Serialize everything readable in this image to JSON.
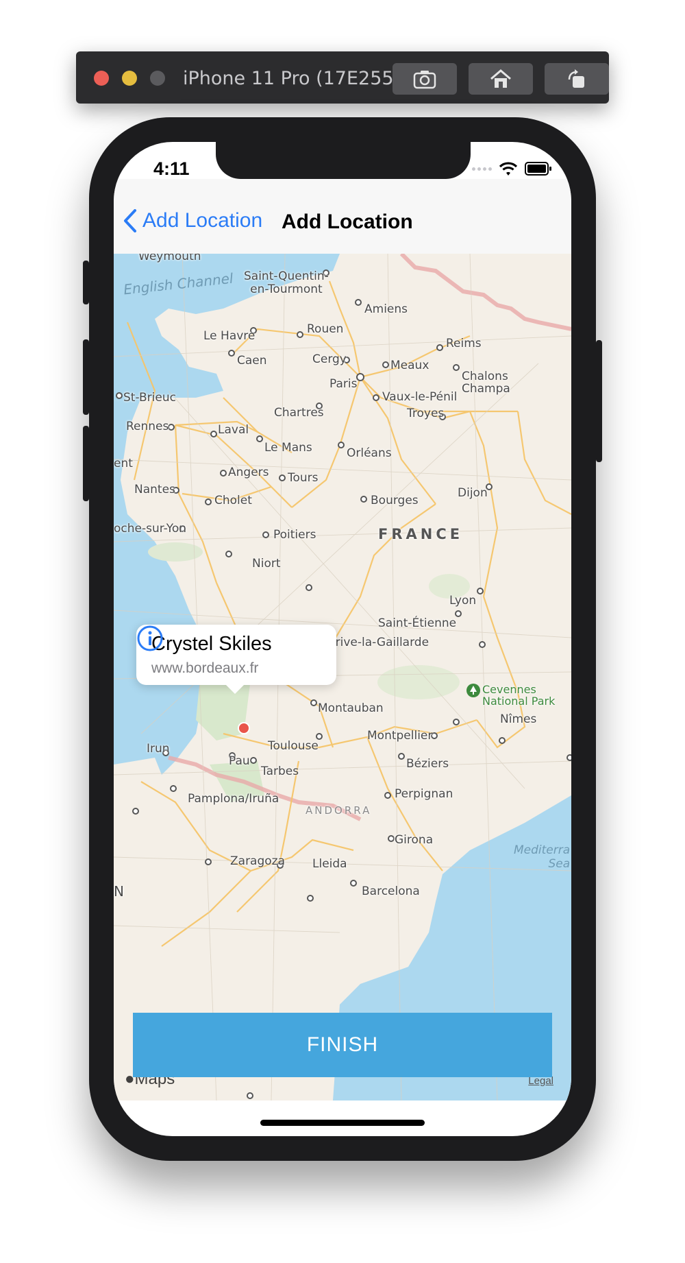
{
  "simulator": {
    "title": "iPhone 11 Pro (17E255)",
    "buttons": [
      "screenshot-icon",
      "home-icon",
      "rotate-icon"
    ]
  },
  "status_bar": {
    "time": "4:11"
  },
  "nav": {
    "back_label": "Add Location",
    "title": "Add Location"
  },
  "map": {
    "labels": {
      "weymouth": "Weymouth",
      "english_channel": "English Channel",
      "saint_quentin": "Saint-Quentin-\nen-Tourmont",
      "amiens": "Amiens",
      "le_havre": "Le Havre",
      "rouen": "Rouen",
      "caen": "Caen",
      "reims": "Reims",
      "cergy": "Cergy",
      "meaux": "Meaux",
      "paris": "Paris",
      "chalons": "Chalons\nChampa",
      "st_brieuc": "St-Brieuc",
      "vaux": "Vaux-le-Pénil",
      "chartres": "Chartres",
      "troyes": "Troyes",
      "rennes": "Rennes",
      "laval": "Laval",
      "le_mans": "Le Mans",
      "orleans": "Orléans",
      "angers": "Angers",
      "tours": "Tours",
      "nantes": "Nantes",
      "dijon": "Dijon",
      "cholet": "Cholet",
      "bourges": "Bourges",
      "roche": "oche-sur-Yon",
      "poitiers": "Poitiers",
      "france": "FRANCE",
      "niort": "Niort",
      "lyon": "Lyon",
      "saint_etienne": "Saint-Étienne",
      "brive": "Brive-la-Gaillarde",
      "cevennes": "Cevennes\nNational Park",
      "montauban": "Montauban",
      "nimes": "Nîmes",
      "montpellier": "Montpellier",
      "irun": "Irun",
      "toulouse": "Toulouse",
      "pau": "Pau",
      "tarbes": "Tarbes",
      "beziers": "Béziers",
      "pamplona": "Pamplona/Iruña",
      "perpignan": "Perpignan",
      "andorra": "ANDORRA",
      "girona": "Girona",
      "mediterranean": "Mediterra\nSea",
      "zaragoza": "Zaragoza",
      "lleida": "Lleida",
      "barcelona": "Barcelona",
      "ent": "ent",
      "n": "N"
    },
    "maps_logo": "Maps",
    "legal": "Legal"
  },
  "callout": {
    "title": "Crystel Skiles",
    "subtitle": "www.bordeaux.fr"
  },
  "finish_button": {
    "label": "FINISH"
  },
  "colors": {
    "accent_blue": "#2b7cf6",
    "finish_blue": "#45a6dd",
    "pin_red": "#e9544a",
    "water": "#acd8ef",
    "land": "#f4efe7",
    "road": "#f6c56a"
  }
}
